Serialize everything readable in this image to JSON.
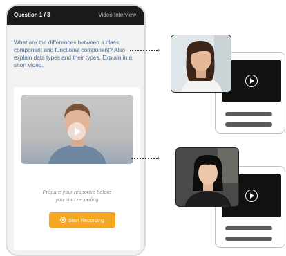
{
  "phone": {
    "question_counter": "Question 1 / 3",
    "mode_label": "Video Interview",
    "question_text": "What are the differences between a class component and functional component? Also explain data types and their types. Explain in a short video.",
    "prepare_line1": "Prepare your response before",
    "prepare_line2": "you start recording",
    "start_button": "Start Recording"
  },
  "icons": {
    "video_play": "play-icon",
    "record": "record-icon"
  },
  "colors": {
    "accent": "#f5a623",
    "question_text": "#4a6a92",
    "topbar": "#1b1b1b"
  }
}
